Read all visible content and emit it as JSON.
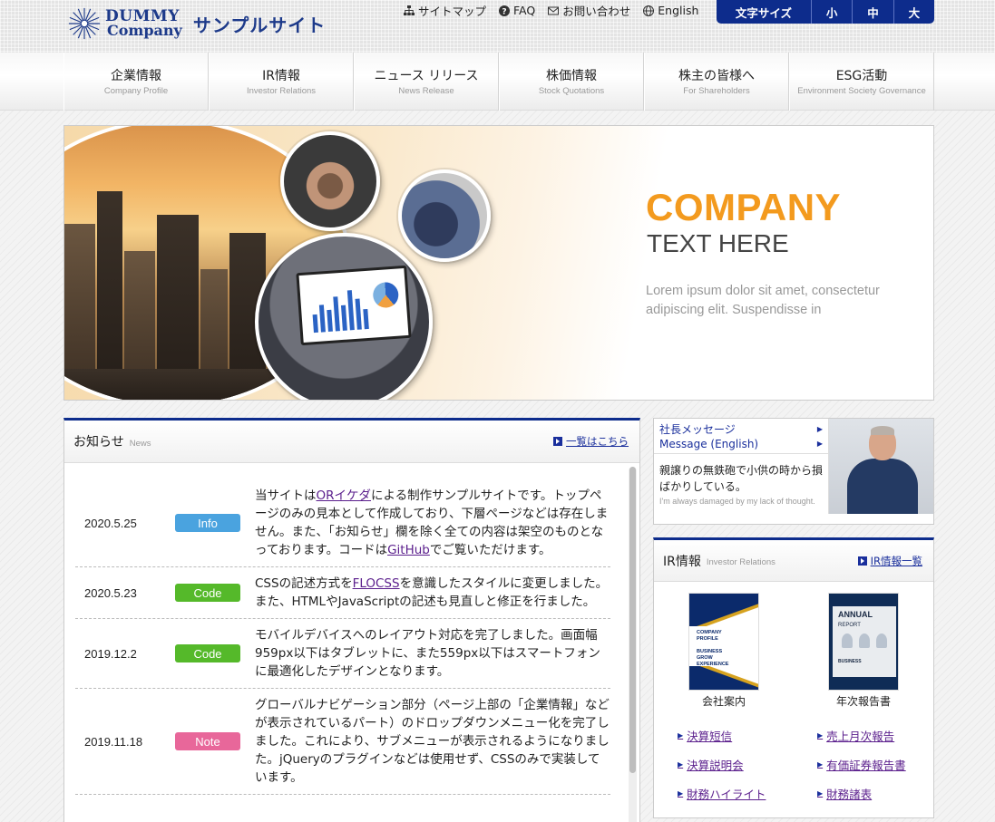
{
  "header": {
    "logo_word1": "DUMMY",
    "logo_word2": "Company",
    "site_name": "サンプルサイト",
    "util_nav": [
      {
        "label": "サイトマップ",
        "icon": "sitemap-icon"
      },
      {
        "label": "FAQ",
        "icon": "question-circle-icon"
      },
      {
        "label": "お問い合わせ",
        "icon": "envelope-icon"
      },
      {
        "label": "English",
        "icon": "globe-icon"
      }
    ],
    "font_size": {
      "label": "文字サイズ",
      "options": [
        "小",
        "中",
        "大"
      ]
    }
  },
  "gnav": [
    {
      "ja": "企業情報",
      "en": "Company Profile"
    },
    {
      "ja": "IR情報",
      "en": "Investor Relations"
    },
    {
      "ja": "ニュース リリース",
      "en": "News Release"
    },
    {
      "ja": "株価情報",
      "en": "Stock Quotations"
    },
    {
      "ja": "株主の皆様へ",
      "en": "For Shareholders"
    },
    {
      "ja": "ESG活動",
      "en": "Environment Society Governance"
    }
  ],
  "hero": {
    "title": "COMPANY",
    "subtitle": "TEXT HERE",
    "body": "Lorem ipsum dolor sit amet, consectetur adipiscing elit. Suspendisse in"
  },
  "news": {
    "title": "お知らせ",
    "title_en": "News",
    "more_label": "一覧はこちら",
    "items": [
      {
        "date": "2020.5.25",
        "tag": "Info",
        "tag_color": "#4aa3df",
        "text_parts": [
          "当サイトは",
          "ORイケダ",
          "による制作サンプルサイトです。トップページのみの見本として作成しており、下層ページなどは存在しません。また、「お知らせ」欄を除く全ての内容は架空のものとなっております。コードは",
          "GitHub",
          "でご覧いただけます。"
        ]
      },
      {
        "date": "2020.5.23",
        "tag": "Code",
        "tag_color": "#55b92a",
        "text_parts": [
          "CSSの記述方式を",
          "FLOCSS",
          "を意識したスタイルに変更しました。また、HTMLやJavaScriptの記述も見直しと修正を行ました。"
        ]
      },
      {
        "date": "2019.12.2",
        "tag": "Code",
        "tag_color": "#55b92a",
        "text": "モバイルデバイスへのレイアウト対応を完了しました。画面幅959px以下はタブレットに、また559px以下はスマートフォンに最適化したデザインとなります。"
      },
      {
        "date": "2019.11.18",
        "tag": "Note",
        "tag_color": "#e8679a",
        "text": "グローバルナビゲーション部分（ページ上部の「企業情報」などが表示されているパート）のドロップダウンメニュー化を完了しました。これにより、サブメニューが表示されるようになりました。jQueryのプラグインなどは使用せず、CSSのみで実装しています。"
      }
    ]
  },
  "message": {
    "link1": "社長メッセージ",
    "link2": "Message (English)",
    "quote": "親譲りの無鉄砲で小供の時から損ばかりしている。",
    "quote_en": "I'm always damaged by my lack of thought."
  },
  "ir": {
    "title": "IR情報",
    "title_en": "Investor Relations",
    "more_label": "IR情報一覧",
    "docs": [
      {
        "label": "会社案内",
        "cover_lines": [
          "COMPANY",
          "PROFILE",
          "BUSINESS",
          "GROW",
          "EXPERIENCE"
        ]
      },
      {
        "label": "年次報告書",
        "cover_lines": [
          "ANNUAL",
          "REPORT",
          "BUSINESS"
        ]
      }
    ],
    "links": [
      "決算短信",
      "売上月次報告",
      "決算説明会",
      "有価証券報告書",
      "財務ハイライト",
      "財務諸表"
    ]
  },
  "colors": {
    "brand_navy": "#0d2c8c",
    "accent_orange": "#f39a1e",
    "link_purple": "#5a1e8c",
    "tag_info": "#4aa3df",
    "tag_code": "#55b92a",
    "tag_note": "#e8679a"
  }
}
